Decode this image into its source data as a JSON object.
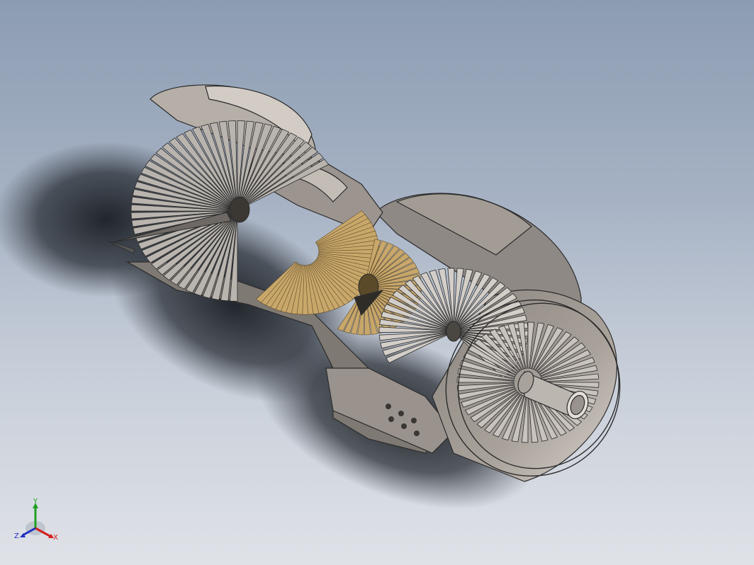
{
  "viewport": {
    "background_top": "#8c9cb2",
    "background_bottom": "#dfe2e7",
    "model_colors": {
      "casing": "#8f8985",
      "casing_light": "#c2bcb6",
      "compressor_blades": "#c9a76a",
      "fan_blades": "#b9b4ae",
      "edges": "#2b2b2b"
    }
  },
  "triad": {
    "x_label": "X",
    "y_label": "Y",
    "z_label": "Z",
    "x_color": "#d22020",
    "y_color": "#20a020",
    "z_color": "#2030c0"
  }
}
